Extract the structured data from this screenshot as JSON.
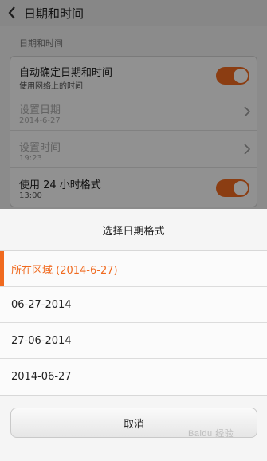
{
  "header": {
    "title": "日期和时间"
  },
  "section": {
    "label": "日期和时间"
  },
  "settings": {
    "auto_time": {
      "label": "自动确定日期和时间",
      "sub": "使用网络上的时间",
      "enabled": true
    },
    "set_date": {
      "label": "设置日期",
      "value": "2014-6-27"
    },
    "set_time": {
      "label": "设置时间",
      "value": "19:23"
    },
    "use_24h": {
      "label": "使用 24 小时格式",
      "sub": "13:00",
      "enabled": true
    }
  },
  "dialog": {
    "title": "选择日期格式",
    "options": [
      {
        "label": "所在区域 (2014-6-27)",
        "selected": true
      },
      {
        "label": "06-27-2014",
        "selected": false
      },
      {
        "label": "27-06-2014",
        "selected": false
      },
      {
        "label": "2014-06-27",
        "selected": false
      }
    ],
    "cancel_label": "取消"
  },
  "colors": {
    "accent": "#f06a1f"
  },
  "watermark": {
    "text": "Baidu 经验"
  }
}
